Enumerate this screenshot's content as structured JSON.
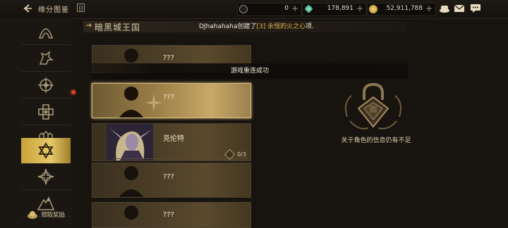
{
  "header": {
    "title": "缘分图鉴",
    "calendar_label": "日",
    "currencies": [
      {
        "name": "c-coin",
        "value": "0"
      },
      {
        "name": "gem",
        "value": "178,891"
      },
      {
        "name": "gold",
        "value": "52,911,788"
      }
    ],
    "plus": "+"
  },
  "sidebar": {
    "items": [
      "item-1",
      "item-2",
      "item-3",
      "item-4",
      "item-5",
      "item-6",
      "item-7",
      "item-8"
    ],
    "active_index": 5,
    "reward_label": "领取奖励"
  },
  "section": {
    "title": "暗黑城王国",
    "notice_user": "DJhahahaha",
    "notice_mid": "创建了",
    "notice_item": "[3] 永恒的火之心",
    "notice_end": "项."
  },
  "toast": "游戏重连成功",
  "cards": [
    {
      "name": "???",
      "progress": ""
    },
    {
      "name": "???",
      "progress": ""
    },
    {
      "name": "克伦特",
      "progress": "0/3"
    },
    {
      "name": "???",
      "progress": ""
    },
    {
      "name": "???",
      "progress": ""
    }
  ],
  "info": {
    "locked_text": "关于角色的信息仍有不足"
  },
  "colors": {
    "accent": "#e6c96a",
    "highlight": "#e9b44a",
    "red_dot": "#e03a2a"
  }
}
